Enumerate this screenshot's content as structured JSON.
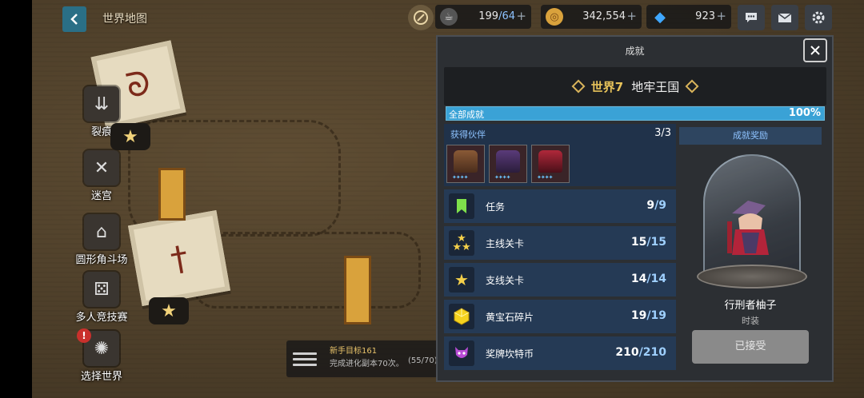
{
  "top": {
    "back_title": "世界地图",
    "stamina": {
      "current": "199",
      "max": "/64",
      "icon": "coffee-icon"
    },
    "gold": {
      "value": "342,554",
      "icon": "coin-icon"
    },
    "gems": {
      "value": "923",
      "icon": "gem-icon"
    },
    "colors": {
      "accent": "#2a6f86",
      "gem": "#3fa7ff",
      "gold": "#d9a23c"
    }
  },
  "side_nav": {
    "items": [
      {
        "label": "裂痕"
      },
      {
        "label": "迷宫"
      },
      {
        "label": "圆形角斗场"
      },
      {
        "label": "多人竞技赛"
      },
      {
        "label": "选择世界"
      }
    ],
    "alert": "!"
  },
  "quest": {
    "title": "新手目标161",
    "desc": "完成进化副本70次。",
    "progress": "(55/70)"
  },
  "panel": {
    "title": "成就",
    "world_num": "世界7",
    "world_name": "地牢王国",
    "overall_label": "全部成就",
    "overall_pct": "100%",
    "overall_fraction": 1.0,
    "partners": {
      "label": "获得伙伴",
      "count": "3/3"
    },
    "achievements": [
      {
        "name": "任务",
        "cur": "9",
        "tot": "/9",
        "icon": "bookmark-icon"
      },
      {
        "name": "主线关卡",
        "cur": "15",
        "tot": "/15",
        "icon": "three-stars-icon"
      },
      {
        "name": "支线关卡",
        "cur": "14",
        "tot": "/14",
        "icon": "star-icon"
      },
      {
        "name": "黄宝石碎片",
        "cur": "19",
        "tot": "/19",
        "icon": "yellow-gem-icon"
      },
      {
        "name": "奖牌坎特币",
        "cur": "210",
        "tot": "/210",
        "icon": "demon-medal-icon"
      }
    ],
    "reward": {
      "header": "成就奖励",
      "name": "行刑者柚子",
      "type": "时装",
      "button": "已接受"
    }
  }
}
